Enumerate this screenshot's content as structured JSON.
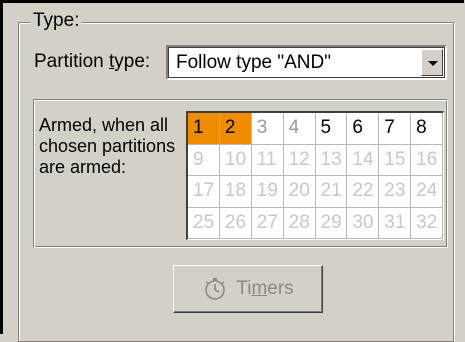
{
  "group": {
    "title": "Type:"
  },
  "partition_type": {
    "label_before": "Partition ",
    "label_underlined": "t",
    "label_after": "ype:",
    "selected_value": "Follow type \"AND\""
  },
  "armed": {
    "label": "Armed, when all chosen partitions are armed:",
    "selected_color": "#f08c00",
    "cells": [
      {
        "n": "1",
        "state": "selected"
      },
      {
        "n": "2",
        "state": "selected"
      },
      {
        "n": "3",
        "state": "disabled"
      },
      {
        "n": "4",
        "state": "disabled"
      },
      {
        "n": "5",
        "state": "enabled"
      },
      {
        "n": "6",
        "state": "enabled"
      },
      {
        "n": "7",
        "state": "enabled"
      },
      {
        "n": "8",
        "state": "enabled"
      },
      {
        "n": "9",
        "state": "unavailable"
      },
      {
        "n": "10",
        "state": "unavailable"
      },
      {
        "n": "11",
        "state": "unavailable"
      },
      {
        "n": "12",
        "state": "unavailable"
      },
      {
        "n": "13",
        "state": "unavailable"
      },
      {
        "n": "14",
        "state": "unavailable"
      },
      {
        "n": "15",
        "state": "unavailable"
      },
      {
        "n": "16",
        "state": "unavailable"
      },
      {
        "n": "17",
        "state": "unavailable"
      },
      {
        "n": "18",
        "state": "unavailable"
      },
      {
        "n": "19",
        "state": "unavailable"
      },
      {
        "n": "20",
        "state": "unavailable"
      },
      {
        "n": "21",
        "state": "unavailable"
      },
      {
        "n": "22",
        "state": "unavailable"
      },
      {
        "n": "23",
        "state": "unavailable"
      },
      {
        "n": "24",
        "state": "unavailable"
      },
      {
        "n": "25",
        "state": "unavailable"
      },
      {
        "n": "26",
        "state": "unavailable"
      },
      {
        "n": "27",
        "state": "unavailable"
      },
      {
        "n": "28",
        "state": "unavailable"
      },
      {
        "n": "29",
        "state": "unavailable"
      },
      {
        "n": "30",
        "state": "unavailable"
      },
      {
        "n": "31",
        "state": "unavailable"
      },
      {
        "n": "32",
        "state": "unavailable"
      }
    ]
  },
  "timers_button": {
    "label_before": "Ti",
    "label_underlined": "m",
    "label_after": "ers",
    "icon": "stopwatch-icon",
    "disabled": true
  }
}
